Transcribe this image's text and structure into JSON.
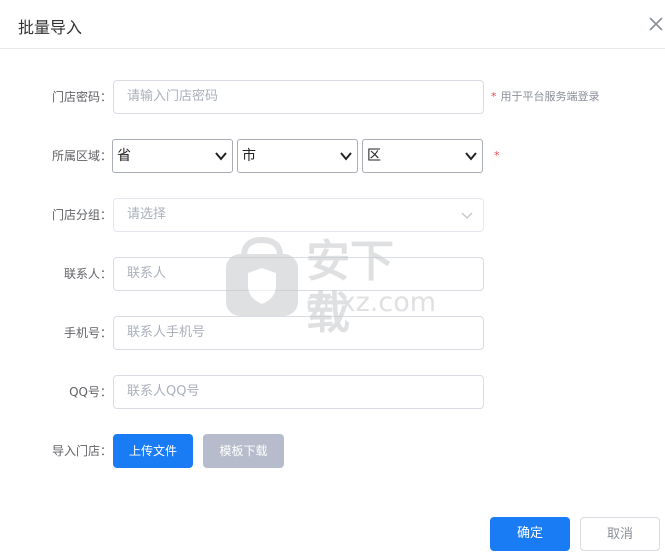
{
  "dialog": {
    "title": "批量导入",
    "close_icon": "close-icon"
  },
  "form": {
    "password": {
      "label": "门店密码：",
      "placeholder": "请输入门店密码",
      "hint_star": "*",
      "hint": "用于平台服务端登录"
    },
    "region": {
      "label": "所属区域：",
      "province": "省",
      "city": "市",
      "district": "区",
      "star": "*"
    },
    "group": {
      "label": "门店分组：",
      "placeholder": "请选择"
    },
    "contact": {
      "label": "联系人：",
      "placeholder": "联系人"
    },
    "phone": {
      "label": "手机号：",
      "placeholder": "联系人手机号"
    },
    "qq": {
      "label": "QQ号：",
      "placeholder": "联系人QQ号"
    },
    "import": {
      "label": "导入门店：",
      "upload_label": "上传文件",
      "template_label": "模板下载"
    }
  },
  "footer": {
    "confirm_label": "确定",
    "cancel_label": "取消"
  },
  "watermark": {
    "text": "安下载",
    "domain": "anxz.com"
  },
  "colors": {
    "primary": "#1a7cf5",
    "required_star": "#f04a4a",
    "template_button": "#b6bccb"
  }
}
